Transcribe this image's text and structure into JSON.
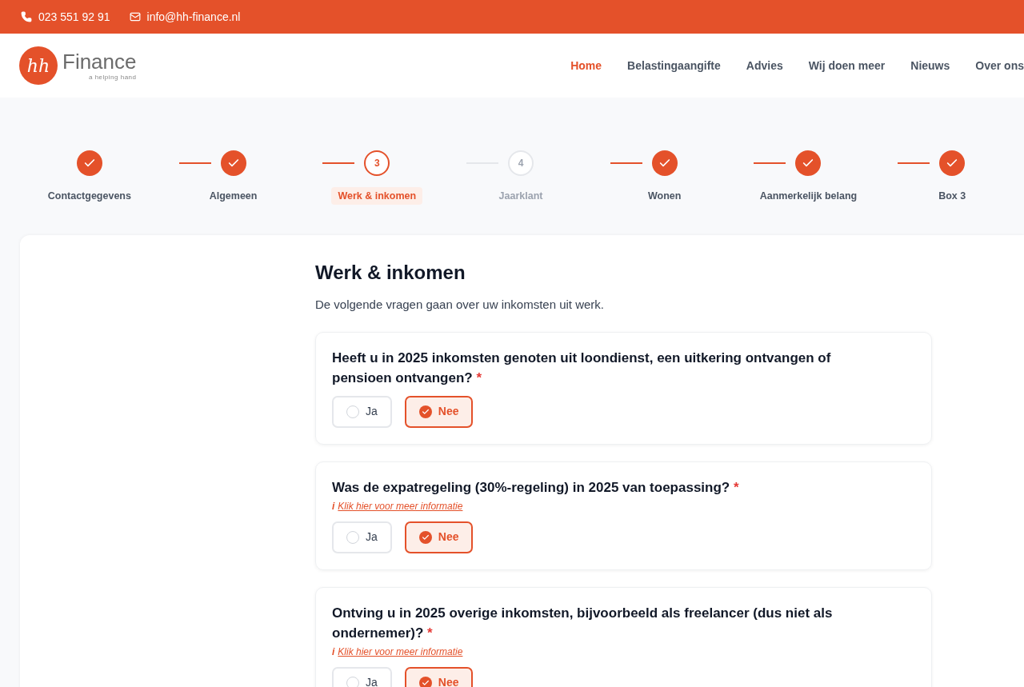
{
  "topbar": {
    "phone": "023 551 92 91",
    "email": "info@hh-finance.nl"
  },
  "logo": {
    "mark": "hh",
    "name": "Finance",
    "tagline": "a helping hand"
  },
  "nav": [
    {
      "label": "Home",
      "selected": true
    },
    {
      "label": "Belastingaangifte",
      "selected": false
    },
    {
      "label": "Advies",
      "selected": false
    },
    {
      "label": "Wij doen meer",
      "selected": false
    },
    {
      "label": "Nieuws",
      "selected": false
    },
    {
      "label": "Over ons",
      "selected": false
    }
  ],
  "steps": [
    {
      "label": "Contactgegevens",
      "kind": "done"
    },
    {
      "label": "Algemeen",
      "kind": "done"
    },
    {
      "label": "Werk & inkomen",
      "kind": "current",
      "number": "3"
    },
    {
      "label": "Jaarklant",
      "kind": "upcoming",
      "number": "4"
    },
    {
      "label": "Wonen",
      "kind": "done"
    },
    {
      "label": "Aanmerkelijk belang",
      "kind": "done"
    },
    {
      "label": "Box 3",
      "kind": "done"
    }
  ],
  "form": {
    "title": "Werk & inkomen",
    "intro": "De volgende vragen gaan over uw inkomsten uit werk.",
    "questions": [
      {
        "text": "Heeft u in 2025 inkomsten genoten uit loondienst, een uitkering ontvangen of pensioen ontvangen?",
        "required_mark": "*",
        "options": [
          {
            "label": "Ja",
            "selected": false
          },
          {
            "label": "Nee",
            "selected": true
          }
        ]
      },
      {
        "text": "Was de expatregeling (30%-regeling) in 2025 van toepassing?",
        "required_mark": "*",
        "info": {
          "mark": "i",
          "link": "Klik hier voor meer informatie"
        },
        "options": [
          {
            "label": "Ja",
            "selected": false
          },
          {
            "label": "Nee",
            "selected": true
          }
        ]
      },
      {
        "text": "Ontving u in 2025 overige inkomsten, bijvoorbeeld als freelancer (dus niet als ondernemer)?",
        "required_mark": "*",
        "info": {
          "mark": "i",
          "link": "Klik hier voor meer informatie"
        },
        "options": [
          {
            "label": "Ja",
            "selected": false
          },
          {
            "label": "Nee",
            "selected": true
          }
        ]
      }
    ]
  }
}
